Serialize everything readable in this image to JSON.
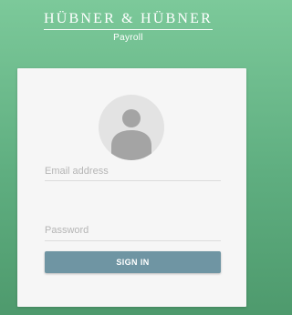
{
  "brand": {
    "name": "HÜBNER & HÜBNER",
    "subtitle": "Payroll"
  },
  "login": {
    "avatar_icon": "user-avatar-icon",
    "email": {
      "value": "",
      "placeholder": "Email address"
    },
    "password": {
      "value": "",
      "placeholder": "Password"
    },
    "signin_label": "SIGN IN"
  },
  "colors": {
    "background_top": "#7cc99a",
    "background_bottom": "#4e9a6d",
    "card": "#f6f6f6",
    "button": "#6f95a3",
    "avatar_bg": "#e3e3e3",
    "avatar_glyph": "#a4a4a4"
  }
}
